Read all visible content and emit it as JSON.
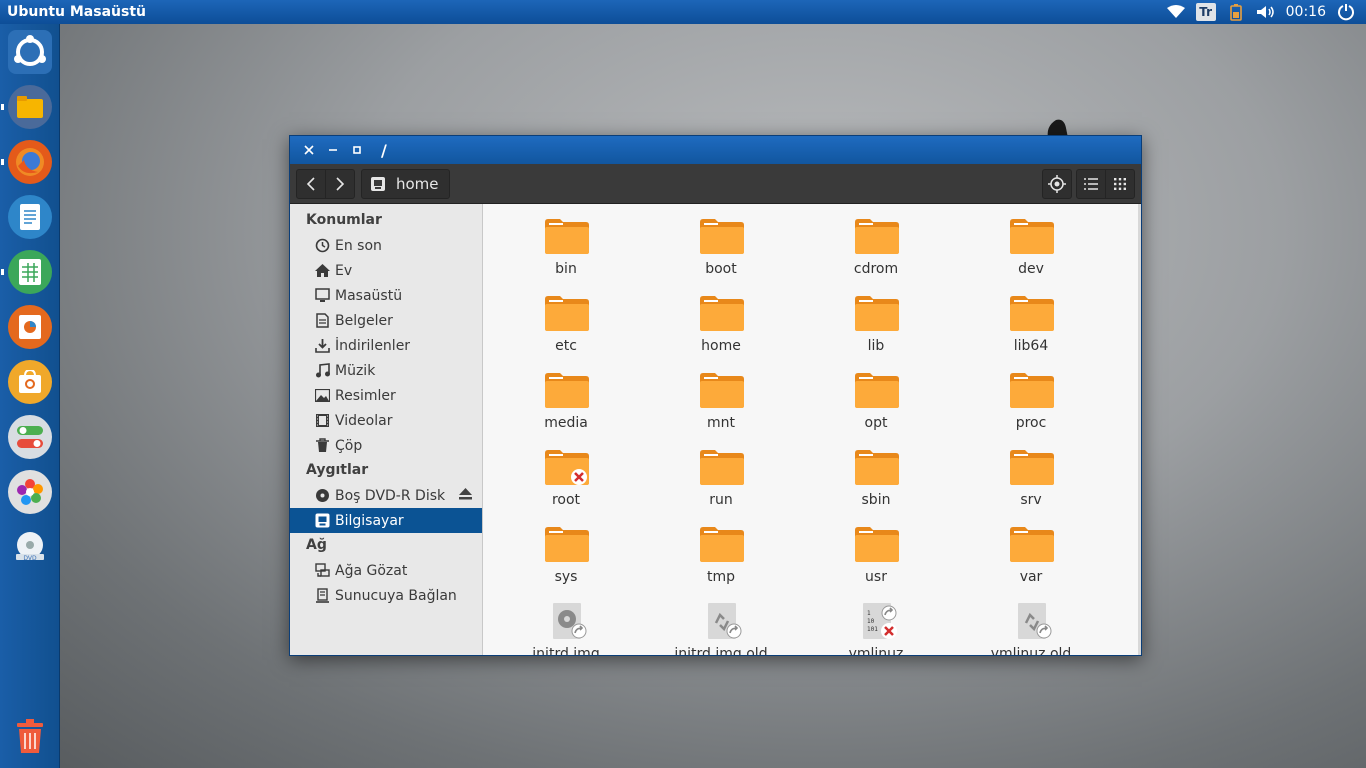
{
  "top_panel": {
    "title": "Ubuntu Masaüstü",
    "keyboard_layout": "Tr",
    "time": "00:16"
  },
  "launcher": {
    "items": [
      "ubuntu-dash",
      "files",
      "firefox",
      "libreoffice-writer",
      "libreoffice-calc",
      "libreoffice-impress",
      "ubuntu-software",
      "system-settings",
      "photos",
      "dvd-drive"
    ],
    "trash": "trash"
  },
  "window": {
    "title": "/",
    "toolbar": {
      "location": "home"
    },
    "sidebar": {
      "sections": [
        {
          "heading": "Konumlar",
          "items": [
            {
              "label": "En son",
              "icon": "clock-icon"
            },
            {
              "label": "Ev",
              "icon": "home-icon"
            },
            {
              "label": "Masaüstü",
              "icon": "desktop-icon"
            },
            {
              "label": "Belgeler",
              "icon": "document-icon"
            },
            {
              "label": "İndirilenler",
              "icon": "download-icon"
            },
            {
              "label": "Müzik",
              "icon": "music-icon"
            },
            {
              "label": "Resimler",
              "icon": "picture-icon"
            },
            {
              "label": "Videolar",
              "icon": "video-icon"
            },
            {
              "label": "Çöp",
              "icon": "trash-icon"
            }
          ]
        },
        {
          "heading": "Aygıtlar",
          "items": [
            {
              "label": "Boş DVD-R Disk",
              "icon": "disc-icon"
            },
            {
              "label": "Bilgisayar",
              "icon": "computer-icon"
            }
          ]
        },
        {
          "heading": "Ağ",
          "items": [
            {
              "label": "Ağa Gözat",
              "icon": "network-icon"
            },
            {
              "label": "Sunucuya Bağlan",
              "icon": "server-icon"
            }
          ]
        }
      ]
    },
    "files": [
      {
        "name": "bin",
        "type": "folder"
      },
      {
        "name": "boot",
        "type": "folder"
      },
      {
        "name": "cdrom",
        "type": "folder"
      },
      {
        "name": "dev",
        "type": "folder"
      },
      {
        "name": "etc",
        "type": "folder"
      },
      {
        "name": "home",
        "type": "folder"
      },
      {
        "name": "lib",
        "type": "folder"
      },
      {
        "name": "lib64",
        "type": "folder"
      },
      {
        "name": "media",
        "type": "folder"
      },
      {
        "name": "mnt",
        "type": "folder"
      },
      {
        "name": "opt",
        "type": "folder"
      },
      {
        "name": "proc",
        "type": "folder"
      },
      {
        "name": "root",
        "type": "folder-locked"
      },
      {
        "name": "run",
        "type": "folder"
      },
      {
        "name": "sbin",
        "type": "folder"
      },
      {
        "name": "srv",
        "type": "folder"
      },
      {
        "name": "sys",
        "type": "folder"
      },
      {
        "name": "tmp",
        "type": "folder"
      },
      {
        "name": "usr",
        "type": "folder"
      },
      {
        "name": "var",
        "type": "folder"
      },
      {
        "name": "initrd.img",
        "type": "disc-link"
      },
      {
        "name": "initrd.img.old",
        "type": "recycle-link"
      },
      {
        "name": "vmlinuz",
        "type": "binary-link-locked"
      },
      {
        "name": "vmlinuz.old",
        "type": "recycle-link"
      }
    ]
  },
  "colors": {
    "accent": "#0b5394",
    "folder": "#f5a623",
    "panel": "#1d66b8"
  }
}
